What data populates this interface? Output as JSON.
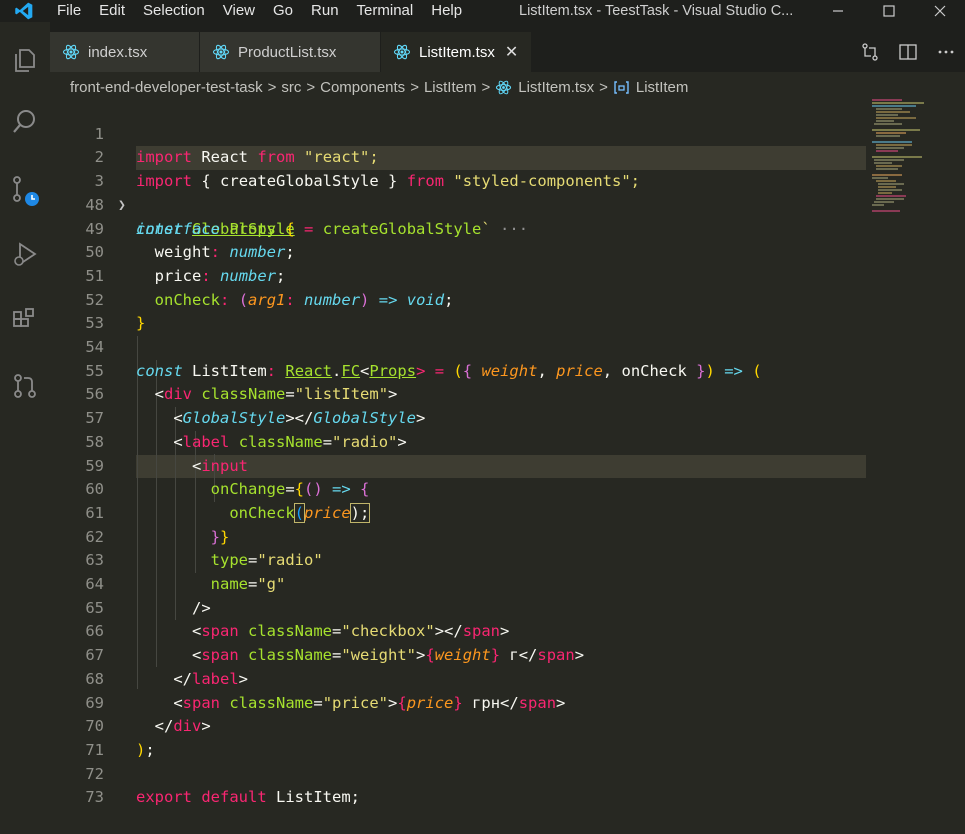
{
  "menu": [
    "File",
    "Edit",
    "Selection",
    "View",
    "Go",
    "Run",
    "Terminal",
    "Help"
  ],
  "window_title": "ListItem.tsx - TeestTask - Visual Studio C...",
  "tabs": [
    {
      "label": "index.tsx"
    },
    {
      "label": "ProductList.tsx"
    },
    {
      "label": "ListItem.tsx",
      "close": "✕"
    }
  ],
  "breadcrumb": [
    "front-end-developer-test-task",
    "src",
    "Components",
    "ListItem",
    "ListItem.tsx",
    "ListItem"
  ],
  "colors": {
    "accent": "#007acc",
    "keyword": "#f92672",
    "string": "#e6db74",
    "type": "#66d9ef",
    "func": "#a6e22e",
    "param": "#fd971f"
  },
  "line_numbers": [
    "1",
    "2",
    "3",
    "48",
    "49",
    "50",
    "51",
    "52",
    "53",
    "54",
    "55",
    "56",
    "57",
    "58",
    "59",
    "60",
    "61",
    "62",
    "63",
    "64",
    "65",
    "66",
    "67",
    "68",
    "69",
    "70",
    "71",
    "72",
    "73"
  ],
  "code": {
    "l1": [
      "import",
      "React",
      "from",
      "\"react\";"
    ],
    "l2": [
      "import",
      "{",
      "createGlobalStyle",
      "}",
      "from",
      "\"styled-components\";"
    ],
    "l3": [
      "const",
      "GlobalStyle",
      "=",
      "createGlobalStyle",
      "`",
      "···"
    ],
    "l48": [
      "interface",
      "Props",
      "{"
    ],
    "l49": [
      "weight",
      ":",
      "number",
      ";"
    ],
    "l50": [
      "price",
      ":",
      "number",
      ";"
    ],
    "l51": [
      "onCheck",
      ":",
      "(",
      "arg1",
      ":",
      "number",
      ")",
      "=>",
      "void",
      ";"
    ],
    "l52": [
      "}"
    ],
    "l54": [
      "const",
      "ListItem",
      ":",
      "React",
      ".",
      "FC",
      "<",
      "Props",
      "> =",
      "(",
      "{",
      "weight",
      ",",
      "price",
      ",",
      "onCheck",
      "}",
      ")",
      "=>",
      "("
    ],
    "l55": [
      "<",
      "div",
      "className",
      "=",
      "\"listItem\"",
      ">"
    ],
    "l56": [
      "<",
      "GlobalStyle",
      "></",
      "GlobalStyle",
      ">"
    ],
    "l57": [
      "<",
      "label",
      "className",
      "=",
      "\"radio\"",
      ">"
    ],
    "l58": [
      "<",
      "input"
    ],
    "l59": [
      "onChange",
      "=",
      "{",
      "()",
      "=>",
      "{"
    ],
    "l60": [
      "onCheck",
      "(",
      "price",
      ");"
    ],
    "l61": [
      "}",
      "}"
    ],
    "l62": [
      "type",
      "=",
      "\"radio\""
    ],
    "l63": [
      "name",
      "=",
      "\"g\""
    ],
    "l64": [
      "/>"
    ],
    "l65": [
      "<",
      "span",
      "className",
      "=",
      "\"checkbox\"",
      "></",
      "span",
      ">"
    ],
    "l66": [
      "<",
      "span",
      "className",
      "=",
      "\"weight\"",
      ">",
      "{",
      "weight",
      "}",
      " г</",
      "span",
      ">"
    ],
    "l67": [
      "</",
      "label",
      ">"
    ],
    "l68": [
      "<",
      "span",
      "className",
      "=",
      "\"price\"",
      ">",
      "{",
      "price",
      "}",
      " грн</",
      "span",
      ">"
    ],
    "l69": [
      "</",
      "div",
      ">"
    ],
    "l70": [
      ")",
      ";"
    ],
    "l72": [
      "export",
      "default",
      "ListItem;"
    ]
  }
}
